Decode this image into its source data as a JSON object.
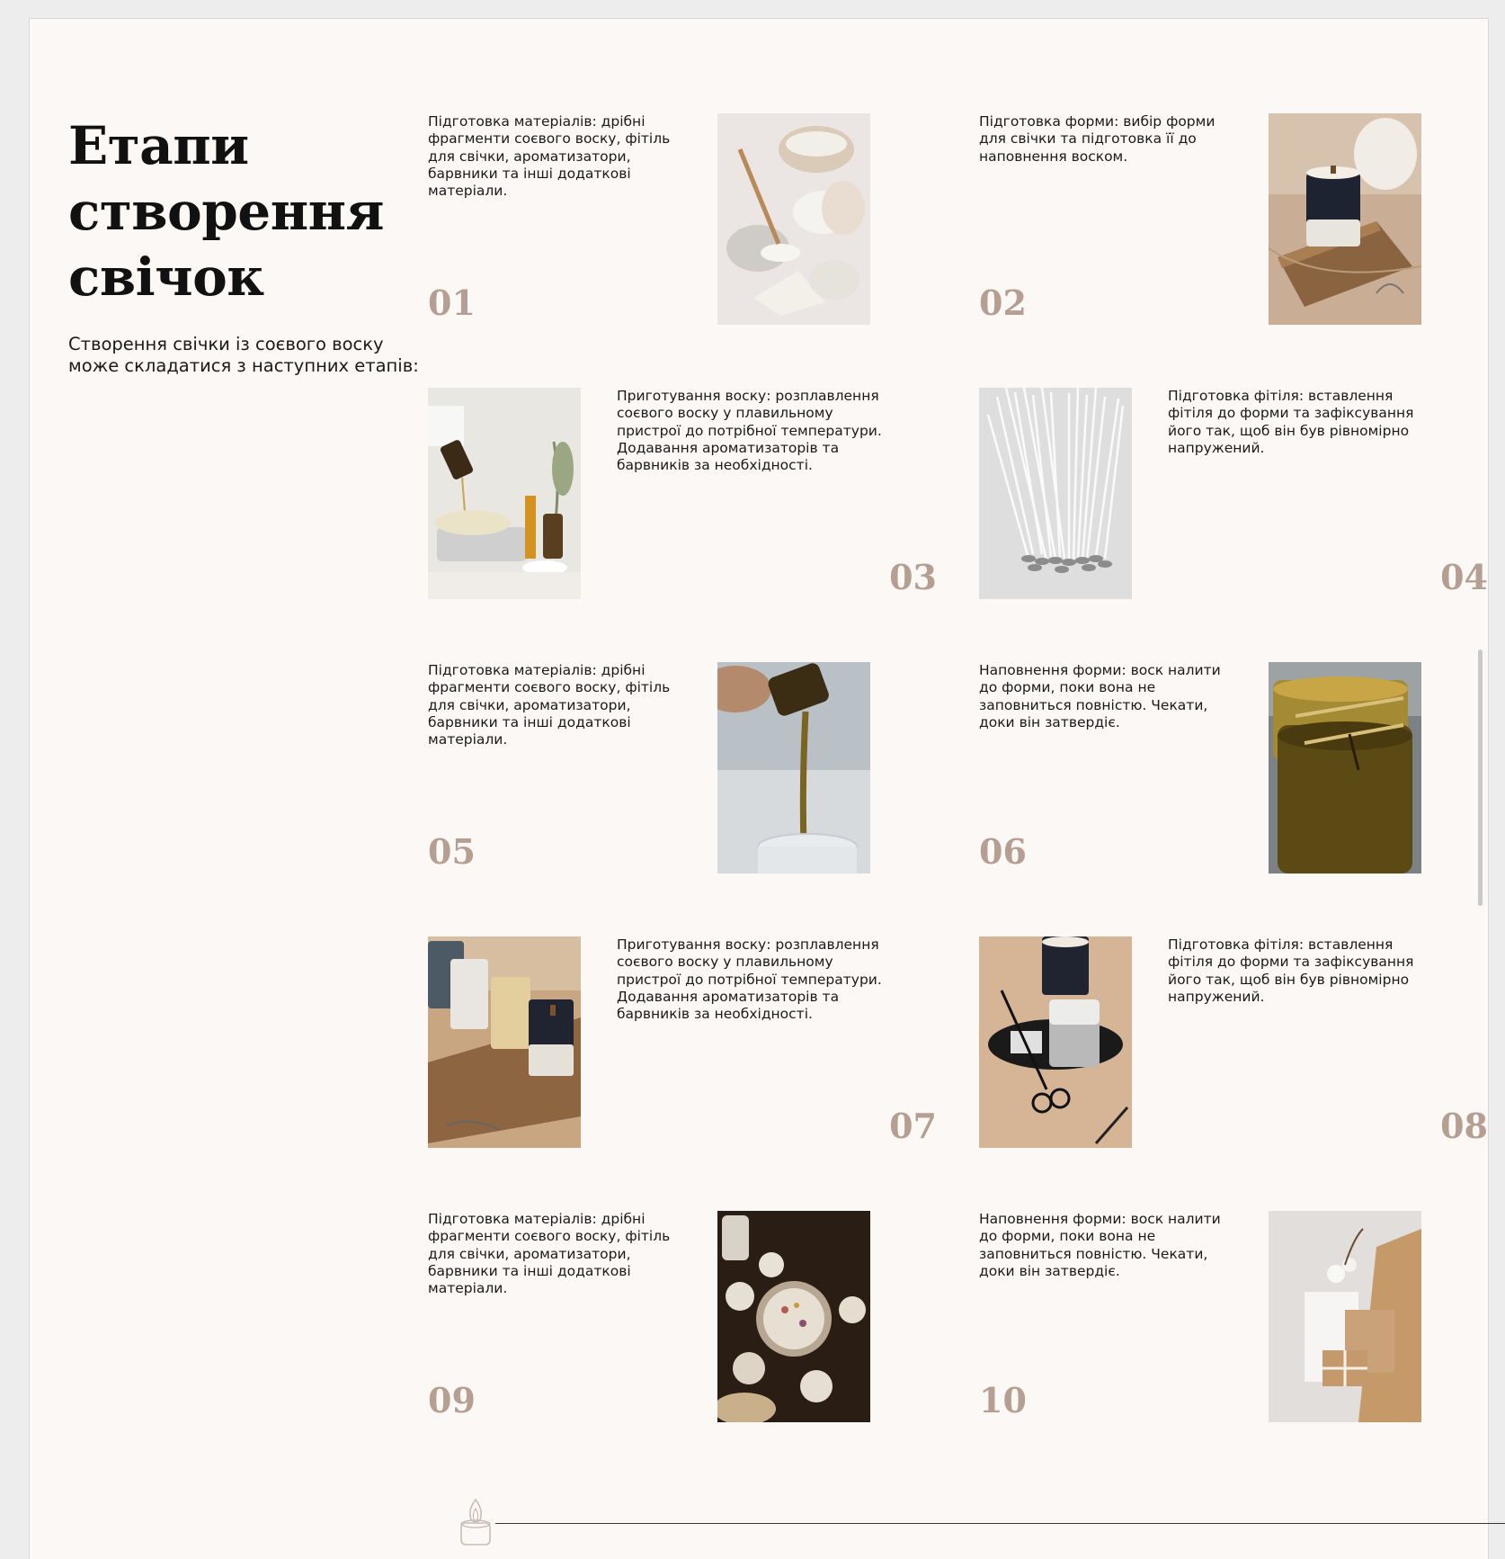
{
  "title_lines": [
    "Етапи",
    "створення",
    "свічок"
  ],
  "intro": "Створення свічки із соєвого воску може складатися з наступних етапів:",
  "steps": [
    {
      "num": "01",
      "text": "Підготовка матеріалів: дрібні фрагменти соєвого воску, фітіль для свічки, ароматизатори, барвники та інші додаткові матеріали.",
      "photo": "coconut-wax-ingredients"
    },
    {
      "num": "02",
      "text": "Підготовка форми: вибір форми для свічки та підготовка її до наповнення воском.",
      "photo": "candle-on-wooden-board"
    },
    {
      "num": "03",
      "text": "Приготування воску: розплавлення соєвого воску у плавильному пристрої до потрібної температури. Додавання ароматизаторів та барвників за необхідності.",
      "photo": "pouring-oil-on-scale"
    },
    {
      "num": "04",
      "text": "Підготовка фітіля: вставлення фітіля до форми та зафіксування його так, щоб він був рівномірно напружений.",
      "photo": "candle-wicks"
    },
    {
      "num": "05",
      "text": "Підготовка матеріалів: дрібні фрагменти соєвого воску, фітіль для свічки, ароматизатори, барвники та інші додаткові матеріали.",
      "photo": "pouring-fragrance-oil"
    },
    {
      "num": "06",
      "text": "Наповнення форми: воск налити до форми, поки вона не заповниться повністю. Чекати, доки він затвердіє.",
      "photo": "wax-filled-glasses"
    },
    {
      "num": "07",
      "text": "Приготування воску: розплавлення соєвого воску у плавильному пристрої до потрібної температури. Додавання ароматизаторів та барвників за необхідності.",
      "photo": "candles-on-board"
    },
    {
      "num": "08",
      "text": "Підготовка фітіля: вставлення фітіля до форми та зафіксування його так, щоб він був рівномірно напружений.",
      "photo": "candle-with-scissors"
    },
    {
      "num": "09",
      "text": "Підготовка матеріалів: дрібні фрагменти соєвого воску, фітіль для свічки, ароматизатори, барвники та інші додаткові матеріали.",
      "photo": "dried-flower-candles"
    },
    {
      "num": "10",
      "text": "Наповнення форми: воск налити до форми, поки вона не заповниться повністю. Чекати, доки він затвердіє.",
      "photo": "gift-packaging"
    }
  ],
  "colors": {
    "page_bg": "#fcf8f5",
    "number": "#b59f92",
    "text": "#1a1a1a",
    "line": "#3a3430"
  },
  "icons": {
    "footer": "candle-icon"
  }
}
